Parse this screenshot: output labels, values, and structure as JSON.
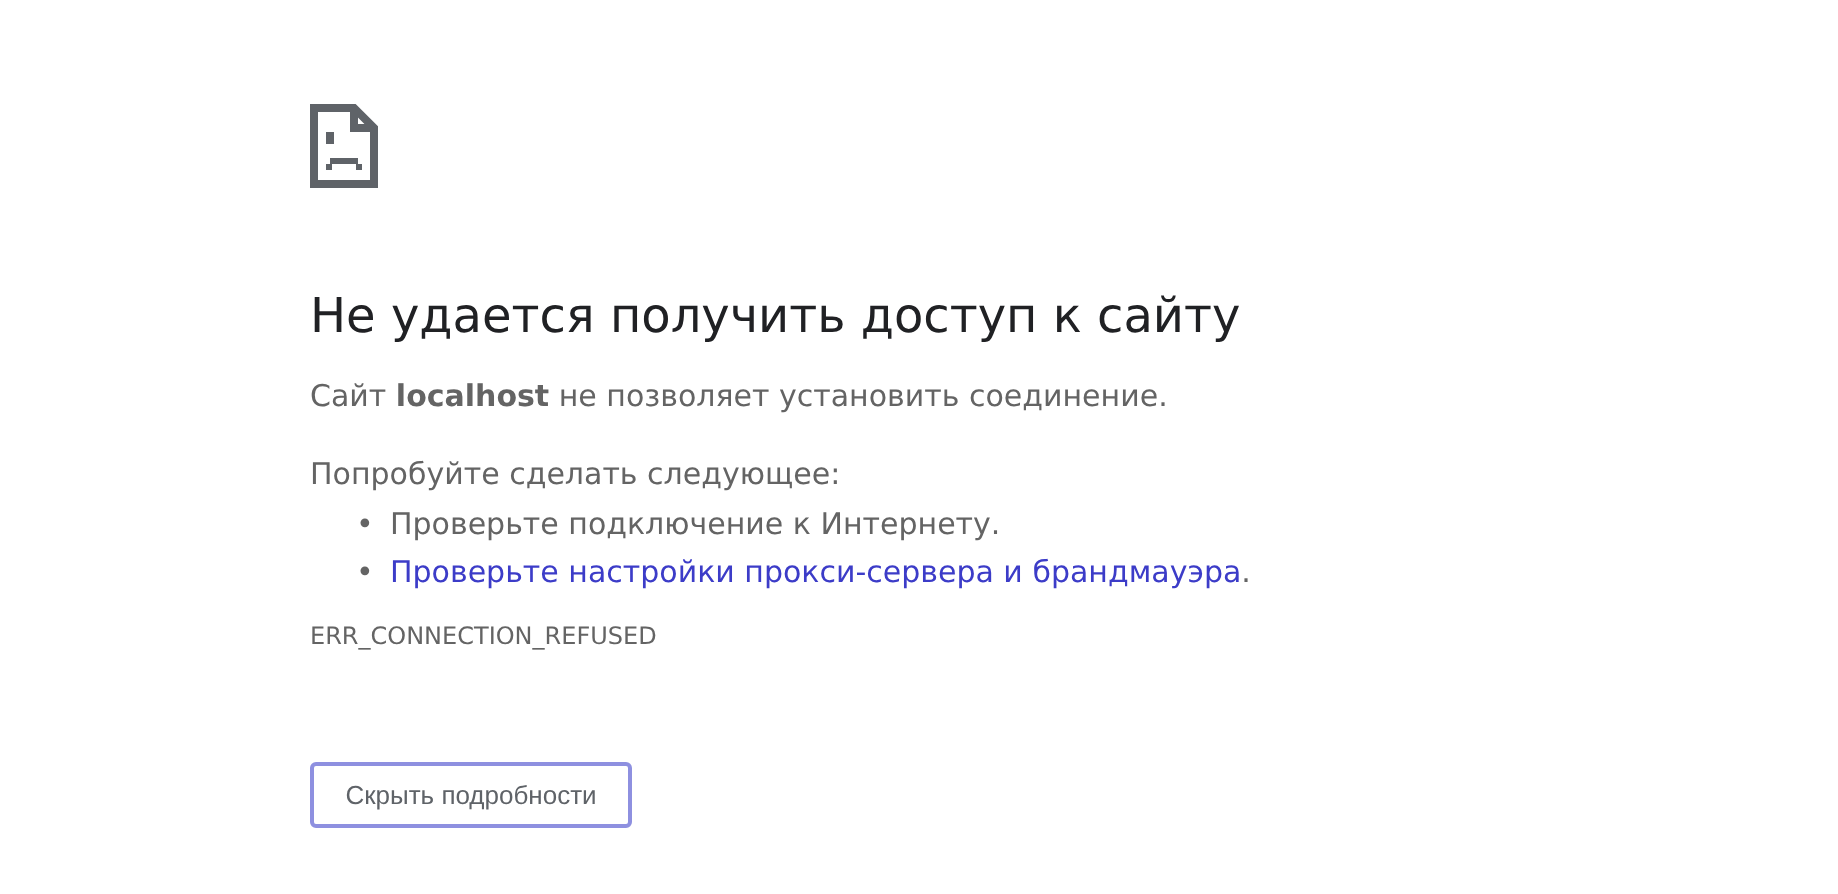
{
  "heading": "Не удается получить доступ к сайту",
  "message": "Сайт **localhost** не позволяет установить соединение.",
  "suggestions_intro": "Попробуйте сделать следующее:",
  "suggestions": [
    {
      "kind": "text",
      "marker": "•",
      "text": "Проверьте подключение к Интернету."
    },
    {
      "kind": "link",
      "marker": "•",
      "text": "Проверьте настройки прокси-сервера и брандмауэра",
      "after": "."
    }
  ],
  "error_code": "ERR_CONNECTION_REFUSED",
  "details_button": "Скрыть подробности"
}
